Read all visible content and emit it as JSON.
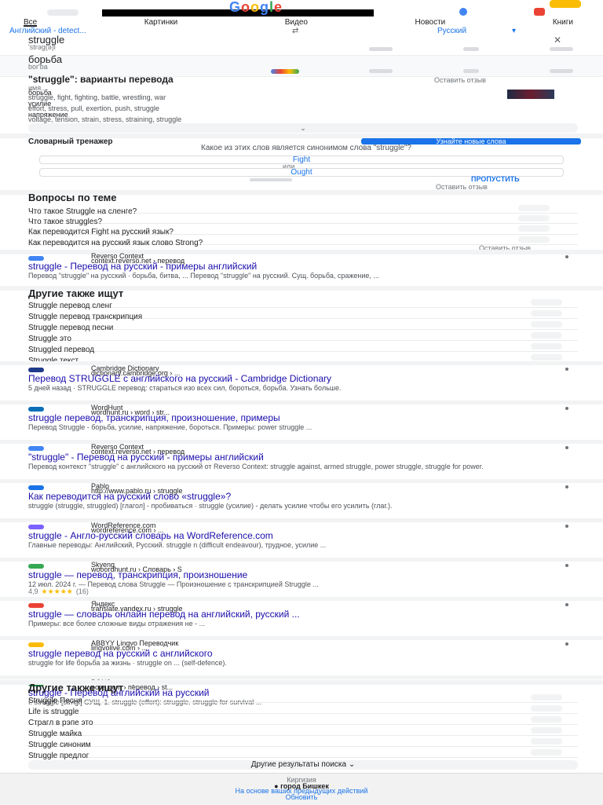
{
  "header": {
    "logo_letters": [
      "G",
      "o",
      "o",
      "g",
      "l",
      "e"
    ],
    "tabs": [
      "Все",
      "Картинки",
      "Видео",
      "Новости",
      "Книги"
    ]
  },
  "translate": {
    "source_lang": "Английский - detect...",
    "target_lang": "Русский",
    "source_word": "struggle",
    "source_phonetic": "'strəg(ə)l",
    "target_word": "борьба",
    "target_phonetic": "bor'ba"
  },
  "variants": {
    "heading": "\"struggle\": варианты перевода",
    "feedback": "Оставить отзыв",
    "noun_label": "имя...",
    "groups": [
      {
        "word": "борьба",
        "values": "struggle, fight, fighting, battle, wrestling, war"
      },
      {
        "word": "усилие",
        "values": "effort, stress, pull, exertion, push, struggle"
      },
      {
        "word": "напряжение",
        "values": "voltage, tension, strain, stress, straining, struggle"
      }
    ]
  },
  "trainer": {
    "title": "Словарный тренажер",
    "button": "Узнайте новые слова",
    "question": "Какое из этих слов является синонимом слова \"struggle\"?",
    "option1": "Fight",
    "or": "или",
    "option2": "Ought",
    "skip": "ПРОПУСТИТЬ",
    "feedback": "Оставить отзыв"
  },
  "paa": {
    "heading": "Вопросы по теме",
    "items": [
      "Что такое Struggle на сленге?",
      "Что такое struggles?",
      "Как переводится Fight на русский язык?",
      "Как переводится на русский язык слово Strong?"
    ],
    "feedback": "Оставить отзыв"
  },
  "results1": [
    {
      "site": "Reverso Context",
      "url": "context.reverso.net › перевод",
      "title": "struggle - Перевод на русский - примеры английский",
      "snippet": "Перевод \"struggle\" на русский · борьба, битва, ... Перевод \"struggle\" на русский. Сущ. борьба, сражение, ..."
    }
  ],
  "also_search1": {
    "heading": "Другие также ищут",
    "items": [
      "Struggle перевод сленг",
      "Struggle перевод транскрипция",
      "Struggle перевод песни",
      "Struggle это",
      "Struggled перевод",
      "Struggle текст"
    ]
  },
  "results2": [
    {
      "site": "Cambridge Dictionary",
      "url": "dictionary.cambridge.org › ...",
      "title": "Перевод STRUGGLE с английского на русский - Cambridge Dictionary",
      "snippet": "5 дней назад · STRUGGLE перевод: стараться изо всех сил, бороться, борьба. Узнать больше."
    },
    {
      "site": "WordHunt",
      "url": "wordhunt.ru › word › str...",
      "title": "struggle перевод, транскрипция, произношение, примеры",
      "snippet": "Перевод Struggle - борьба, усилие, напряжение, бороться. Примеры: power struggle ..."
    },
    {
      "site": "Reverso Context",
      "url": "context.reverso.net › перевод",
      "title": "\"struggle\" - Перевод на русский - примеры английский",
      "snippet": "Перевод контекст \"struggle\" с английского на русский от Reverso Context: struggle against, armed struggle, power struggle, struggle for power."
    },
    {
      "site": "Pablo",
      "url": "http://www.pablo.ru › struggle",
      "title": "Как переводится на русский слово «struggle»?",
      "snippet": "struggle (struggle, struggled) [глагол] - пробиваться · struggle (усилие) - делать усилие чтобы его усилить (глаг.)."
    },
    {
      "site": "WordReference.com",
      "url": "wordreference.com › ...",
      "title": "struggle - Англо-русский словарь на WordReference.com",
      "snippet": "Главные переводы: Английский, Русский. struggle n (difficult endeavour), трудное, усилие ..."
    },
    {
      "site": "Skyeng",
      "url": "wooordhunt.ru › Словарь › S",
      "title": "struggle — перевод, транскрипция, произношение",
      "snippet": "12 июл. 2024 г. — Перевод слова Struggle — Произношение с транскрипцией Struggle ..."
    },
    {
      "site": "Яндекс",
      "url": "translate.yandex.ru › struggle",
      "title": "struggle — словарь онлайн перевод на английский, русский ...",
      "snippet": "Примеры: все более сложные виды отражения не - ..."
    },
    {
      "site": "ABBYY Lingvo Переводчик",
      "url": "lingvolive.com › ...",
      "title": "struggle перевод на русский с английского",
      "snippet": "struggle for life борьба за жизнь · struggle on ... (self-defence)."
    },
    {
      "site": "PONS словарь",
      "url": "pons.com › перевод › st...",
      "title": "struggle - Перевод английский на русский",
      "snippet": "I. struggle [strʌgl] СУЩ. 1. struggle (effort): struggle. struggle for survival ..."
    }
  ],
  "rating": {
    "stars": "★★★★★",
    "count": "(16)",
    "value": "4,9"
  },
  "also_search2": {
    "heading": "Другие также ищут",
    "items": [
      "Struggle Песня",
      "Life is struggle",
      "Страгл в рэпе это",
      "Struggle майка",
      "Struggle синоним",
      "Struggle предлог"
    ]
  },
  "more_results": "Другие результаты поиска",
  "footer": {
    "city": "Киргизия",
    "location": "город Бишкек",
    "based_on": "На основе ваших предыдущих действий",
    "update": "Обновить"
  }
}
